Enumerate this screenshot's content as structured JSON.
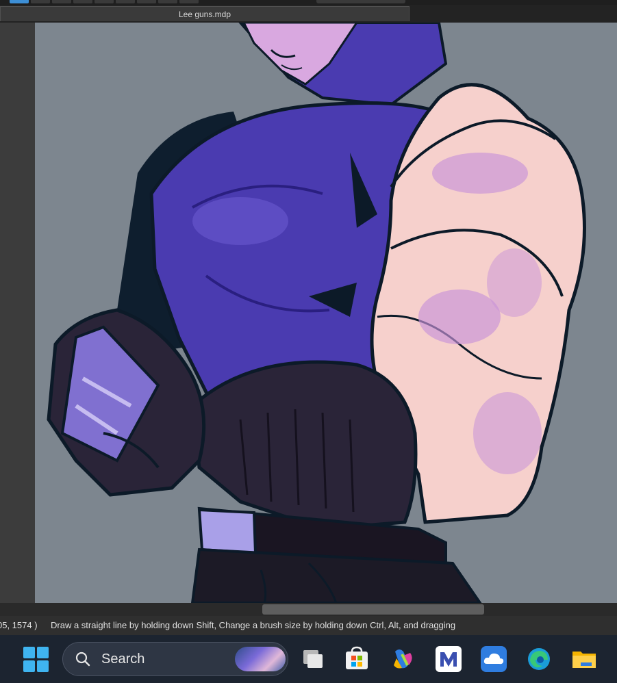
{
  "document": {
    "tab_title": "Lee guns.mdp"
  },
  "statusbar": {
    "coords": "05, 1574 )",
    "hint": "Draw a straight line by holding down Shift, Change a brush size by holding down Ctrl, Alt, and dragging"
  },
  "taskbar": {
    "search_label": "Search",
    "apps": [
      "task-view-icon",
      "store-icon",
      "copilot-icon",
      "mail-icon",
      "onedrive-icon",
      "edge-icon",
      "file-explorer-icon"
    ]
  },
  "colors": {
    "canvas_bg": "#7d868f",
    "shirt": "#4a3bb0",
    "skin": "#f6d0cc",
    "glove": "#2a2438",
    "outline": "#0c1a28",
    "accent": "#3d8fd6"
  }
}
